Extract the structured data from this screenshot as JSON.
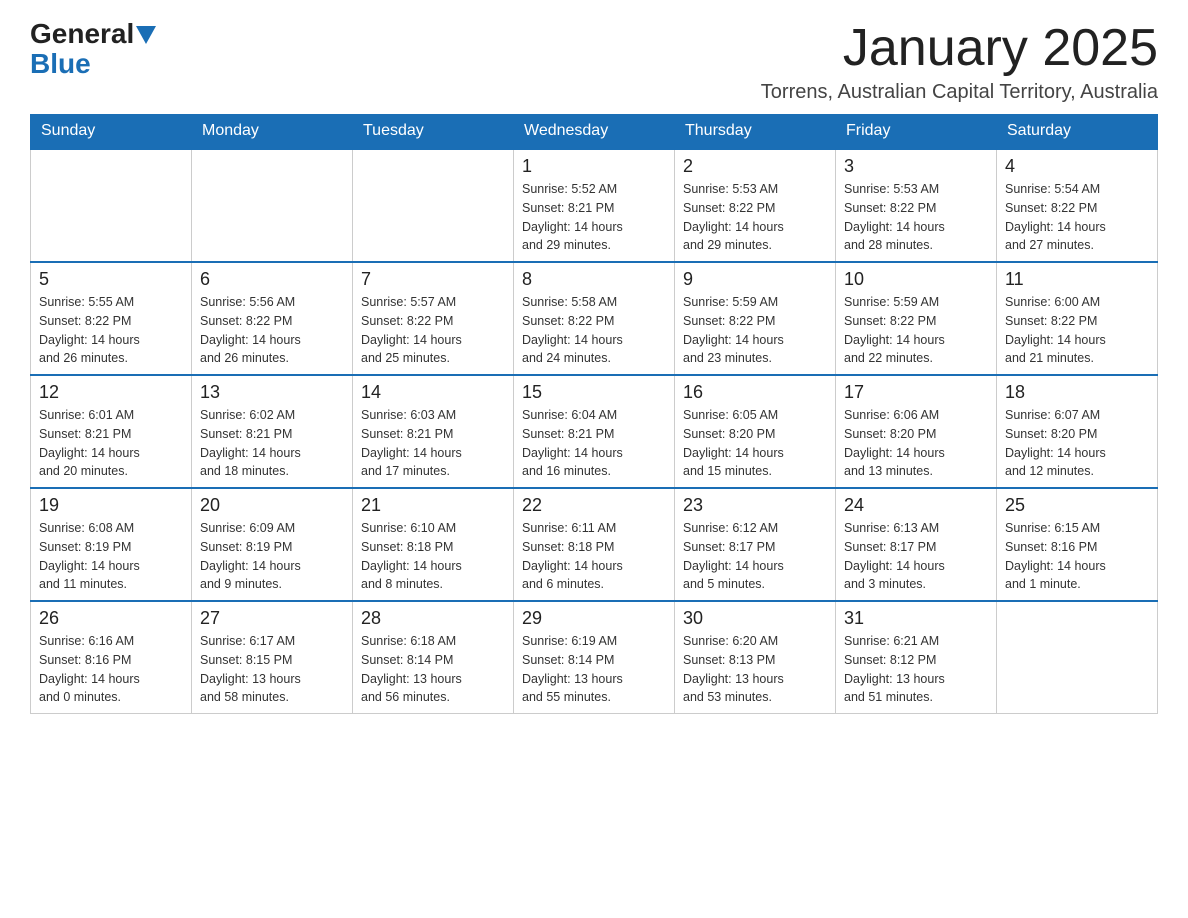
{
  "logo": {
    "general": "General",
    "blue": "Blue"
  },
  "title": "January 2025",
  "location": "Torrens, Australian Capital Territory, Australia",
  "days_of_week": [
    "Sunday",
    "Monday",
    "Tuesday",
    "Wednesday",
    "Thursday",
    "Friday",
    "Saturday"
  ],
  "weeks": [
    [
      {
        "day": "",
        "info": ""
      },
      {
        "day": "",
        "info": ""
      },
      {
        "day": "",
        "info": ""
      },
      {
        "day": "1",
        "info": "Sunrise: 5:52 AM\nSunset: 8:21 PM\nDaylight: 14 hours\nand 29 minutes."
      },
      {
        "day": "2",
        "info": "Sunrise: 5:53 AM\nSunset: 8:22 PM\nDaylight: 14 hours\nand 29 minutes."
      },
      {
        "day": "3",
        "info": "Sunrise: 5:53 AM\nSunset: 8:22 PM\nDaylight: 14 hours\nand 28 minutes."
      },
      {
        "day": "4",
        "info": "Sunrise: 5:54 AM\nSunset: 8:22 PM\nDaylight: 14 hours\nand 27 minutes."
      }
    ],
    [
      {
        "day": "5",
        "info": "Sunrise: 5:55 AM\nSunset: 8:22 PM\nDaylight: 14 hours\nand 26 minutes."
      },
      {
        "day": "6",
        "info": "Sunrise: 5:56 AM\nSunset: 8:22 PM\nDaylight: 14 hours\nand 26 minutes."
      },
      {
        "day": "7",
        "info": "Sunrise: 5:57 AM\nSunset: 8:22 PM\nDaylight: 14 hours\nand 25 minutes."
      },
      {
        "day": "8",
        "info": "Sunrise: 5:58 AM\nSunset: 8:22 PM\nDaylight: 14 hours\nand 24 minutes."
      },
      {
        "day": "9",
        "info": "Sunrise: 5:59 AM\nSunset: 8:22 PM\nDaylight: 14 hours\nand 23 minutes."
      },
      {
        "day": "10",
        "info": "Sunrise: 5:59 AM\nSunset: 8:22 PM\nDaylight: 14 hours\nand 22 minutes."
      },
      {
        "day": "11",
        "info": "Sunrise: 6:00 AM\nSunset: 8:22 PM\nDaylight: 14 hours\nand 21 minutes."
      }
    ],
    [
      {
        "day": "12",
        "info": "Sunrise: 6:01 AM\nSunset: 8:21 PM\nDaylight: 14 hours\nand 20 minutes."
      },
      {
        "day": "13",
        "info": "Sunrise: 6:02 AM\nSunset: 8:21 PM\nDaylight: 14 hours\nand 18 minutes."
      },
      {
        "day": "14",
        "info": "Sunrise: 6:03 AM\nSunset: 8:21 PM\nDaylight: 14 hours\nand 17 minutes."
      },
      {
        "day": "15",
        "info": "Sunrise: 6:04 AM\nSunset: 8:21 PM\nDaylight: 14 hours\nand 16 minutes."
      },
      {
        "day": "16",
        "info": "Sunrise: 6:05 AM\nSunset: 8:20 PM\nDaylight: 14 hours\nand 15 minutes."
      },
      {
        "day": "17",
        "info": "Sunrise: 6:06 AM\nSunset: 8:20 PM\nDaylight: 14 hours\nand 13 minutes."
      },
      {
        "day": "18",
        "info": "Sunrise: 6:07 AM\nSunset: 8:20 PM\nDaylight: 14 hours\nand 12 minutes."
      }
    ],
    [
      {
        "day": "19",
        "info": "Sunrise: 6:08 AM\nSunset: 8:19 PM\nDaylight: 14 hours\nand 11 minutes."
      },
      {
        "day": "20",
        "info": "Sunrise: 6:09 AM\nSunset: 8:19 PM\nDaylight: 14 hours\nand 9 minutes."
      },
      {
        "day": "21",
        "info": "Sunrise: 6:10 AM\nSunset: 8:18 PM\nDaylight: 14 hours\nand 8 minutes."
      },
      {
        "day": "22",
        "info": "Sunrise: 6:11 AM\nSunset: 8:18 PM\nDaylight: 14 hours\nand 6 minutes."
      },
      {
        "day": "23",
        "info": "Sunrise: 6:12 AM\nSunset: 8:17 PM\nDaylight: 14 hours\nand 5 minutes."
      },
      {
        "day": "24",
        "info": "Sunrise: 6:13 AM\nSunset: 8:17 PM\nDaylight: 14 hours\nand 3 minutes."
      },
      {
        "day": "25",
        "info": "Sunrise: 6:15 AM\nSunset: 8:16 PM\nDaylight: 14 hours\nand 1 minute."
      }
    ],
    [
      {
        "day": "26",
        "info": "Sunrise: 6:16 AM\nSunset: 8:16 PM\nDaylight: 14 hours\nand 0 minutes."
      },
      {
        "day": "27",
        "info": "Sunrise: 6:17 AM\nSunset: 8:15 PM\nDaylight: 13 hours\nand 58 minutes."
      },
      {
        "day": "28",
        "info": "Sunrise: 6:18 AM\nSunset: 8:14 PM\nDaylight: 13 hours\nand 56 minutes."
      },
      {
        "day": "29",
        "info": "Sunrise: 6:19 AM\nSunset: 8:14 PM\nDaylight: 13 hours\nand 55 minutes."
      },
      {
        "day": "30",
        "info": "Sunrise: 6:20 AM\nSunset: 8:13 PM\nDaylight: 13 hours\nand 53 minutes."
      },
      {
        "day": "31",
        "info": "Sunrise: 6:21 AM\nSunset: 8:12 PM\nDaylight: 13 hours\nand 51 minutes."
      },
      {
        "day": "",
        "info": ""
      }
    ]
  ]
}
